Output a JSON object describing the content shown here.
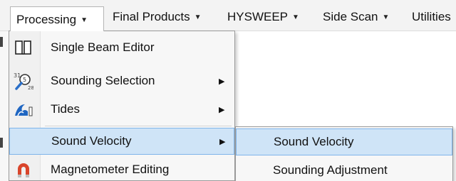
{
  "menubar": {
    "items": [
      {
        "label": "Processing",
        "arrow": "▼"
      },
      {
        "label": "Final Products",
        "arrow": "▼"
      },
      {
        "label": "HYSWEEP",
        "arrow": "▼"
      },
      {
        "label": "Side Scan",
        "arrow": "▼"
      },
      {
        "label": "Utilities"
      }
    ]
  },
  "processing_menu": {
    "items": [
      {
        "label": "Single Beam Editor",
        "icon": "single-beam-editor-icon"
      },
      {
        "label": "Sounding Selection",
        "icon": "sounding-selection-icon",
        "arrow": "▶"
      },
      {
        "label": "Tides",
        "icon": "tides-icon",
        "arrow": "▶"
      },
      {
        "label": "Sound Velocity",
        "arrow": "▶"
      },
      {
        "label": "Magnetometer Editing",
        "icon": "magnetometer-icon"
      }
    ]
  },
  "sound_velocity_submenu": {
    "items": [
      {
        "label": "Sound Velocity"
      },
      {
        "label": "Sounding Adjustment"
      }
    ]
  },
  "colors": {
    "highlight_fill": "#cfe4f7",
    "highlight_border": "#7eb4ea",
    "menu_background": "#f7f7f7"
  }
}
